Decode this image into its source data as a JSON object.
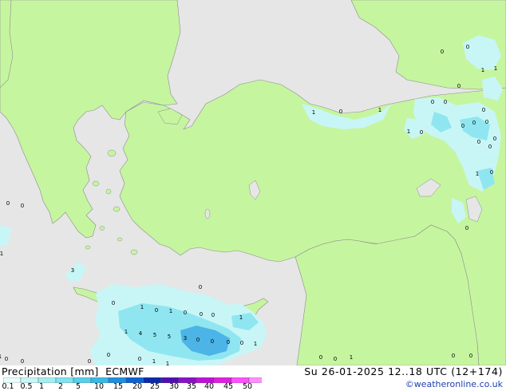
{
  "product": {
    "title": "Precipitation [mm]",
    "model": "ECMWF",
    "valid_time": "Su 26-01-2025 12..18 UTC (12+174)",
    "credit": "©weatheronline.co.uk"
  },
  "legend": {
    "ticks": [
      "0.1",
      "0.5",
      "1",
      "2",
      "5",
      "10",
      "15",
      "20",
      "25",
      "30",
      "35",
      "40",
      "45",
      "50"
    ],
    "colors": [
      "#e8fdfd",
      "#c8f6f6",
      "#a4eef0",
      "#80e2ee",
      "#58cfea",
      "#38b8e6",
      "#1e8ee0",
      "#1060d0",
      "#0a2aa8",
      "#5010b0",
      "#8a10c8",
      "#c010d8",
      "#e020e0",
      "#ff50ff",
      "#ff90ff"
    ]
  },
  "map": {
    "colors": {
      "sea": "#e6e6e6",
      "land": "#c6f5a0",
      "precip_light": "#c8f6f6",
      "precip_mid": "#8fe6f0",
      "precip_heavy": "#4cb4e6",
      "coast": "#8c8c8c"
    },
    "value_labels": [
      "1",
      "0",
      "1",
      "0",
      "0",
      "1",
      "1",
      "0",
      "0",
      "1",
      "0",
      "0",
      "0",
      "0",
      "0",
      "1",
      "0",
      "0",
      "0",
      "0",
      "1",
      "3",
      "0",
      "1",
      "0",
      "1",
      "0",
      "0",
      "0",
      "0",
      "1",
      "1",
      "4",
      "5",
      "5",
      "3",
      "0",
      "0",
      "0",
      "0",
      "1",
      "0",
      "0",
      "1",
      "1",
      "0",
      "0",
      "0",
      "0",
      "0",
      "1",
      "1",
      "0",
      "0",
      "0",
      "0",
      "0",
      "0"
    ]
  }
}
